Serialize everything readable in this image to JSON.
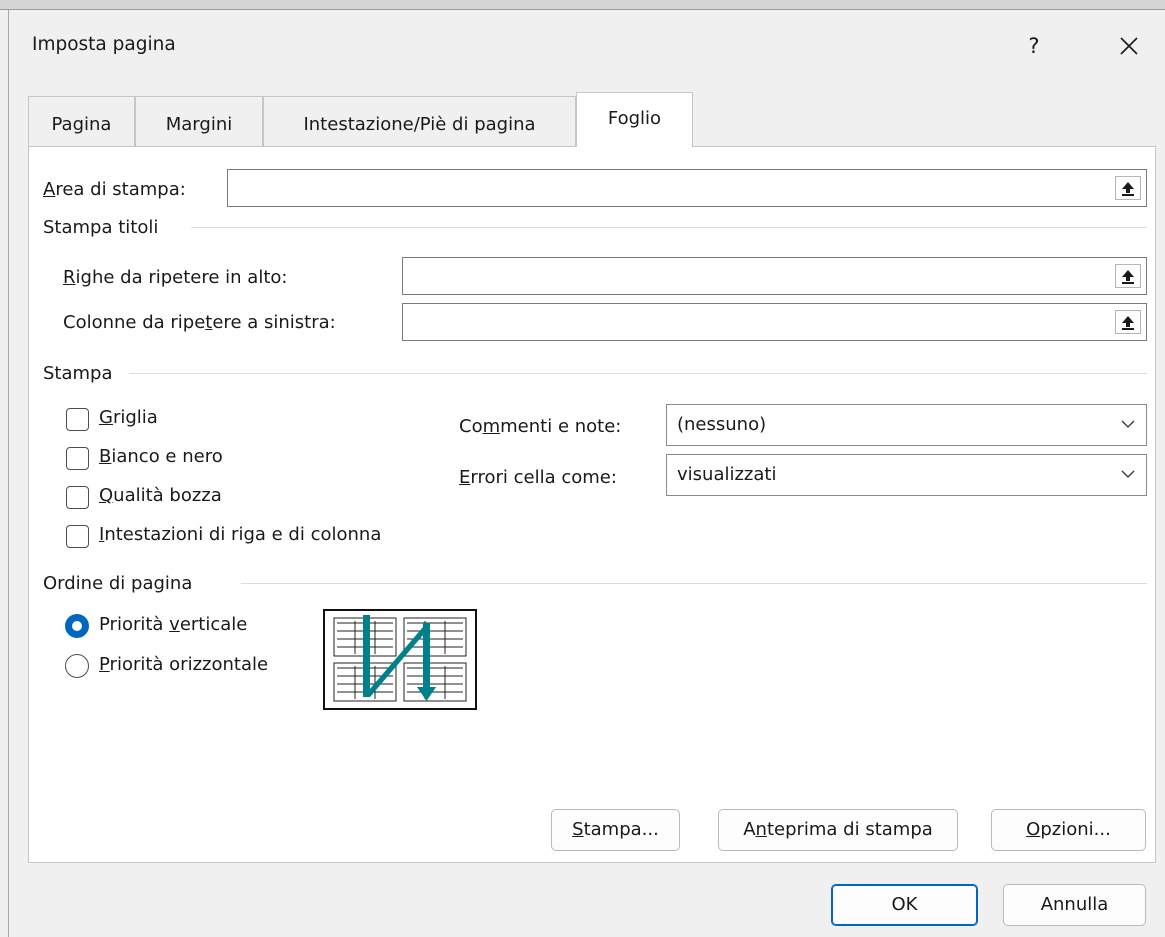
{
  "dialog": {
    "title": "Imposta pagina",
    "help_label": "?"
  },
  "tabs": [
    {
      "label": "Pagina",
      "active": false
    },
    {
      "label": "Margini",
      "active": false
    },
    {
      "label": "Intestazione/Piè di pagina",
      "active": false
    },
    {
      "label": "Foglio",
      "active": true
    }
  ],
  "print_area": {
    "label_first": "A",
    "label_rest": "rea di stampa:",
    "value": ""
  },
  "print_titles": {
    "heading": "Stampa titoli",
    "rows_label_first": "R",
    "rows_label_rest": "ighe da ripetere in alto:",
    "rows_value": "",
    "cols_label_pre": "Colonne da ripe",
    "cols_label_u": "t",
    "cols_label_post": "ere a sinistra:",
    "cols_value": ""
  },
  "print": {
    "heading": "Stampa",
    "checkboxes": [
      {
        "first": "G",
        "rest": "riglia",
        "checked": false
      },
      {
        "first": "B",
        "rest": "ianco e nero",
        "checked": false
      },
      {
        "first": "Q",
        "rest": "ualità bozza",
        "checked": false
      },
      {
        "first": "I",
        "rest": "ntestazioni di riga e di colonna",
        "checked": false
      }
    ],
    "comments_label_pre": "Co",
    "comments_label_u": "m",
    "comments_label_post": "menti e note:",
    "comments_value": "(nessuno)",
    "errors_label_first": "E",
    "errors_label_rest": "rrori cella come:",
    "errors_value": "visualizzati"
  },
  "page_order": {
    "heading": "Ordine di pagina",
    "down_pre": "Priorità ",
    "down_u": "v",
    "down_post": "erticale",
    "down_selected": true,
    "over_pre": "",
    "over_u": "P",
    "over_post": "riorità orizzontale",
    "over_selected": false
  },
  "panel_buttons": {
    "print_first": "S",
    "print_rest": "tampa...",
    "preview_pre": "A",
    "preview_u": "n",
    "preview_post": "teprima di stampa",
    "options_first": "O",
    "options_rest": "pzioni..."
  },
  "footer": {
    "ok": "OK",
    "cancel": "Annulla"
  },
  "colors": {
    "accent": "#0067c0",
    "order_arrow": "#00808a"
  },
  "icons": {
    "help": "question-mark",
    "close": "close-x",
    "collapse": "upload-arrow",
    "dropdown": "chevron-down"
  }
}
